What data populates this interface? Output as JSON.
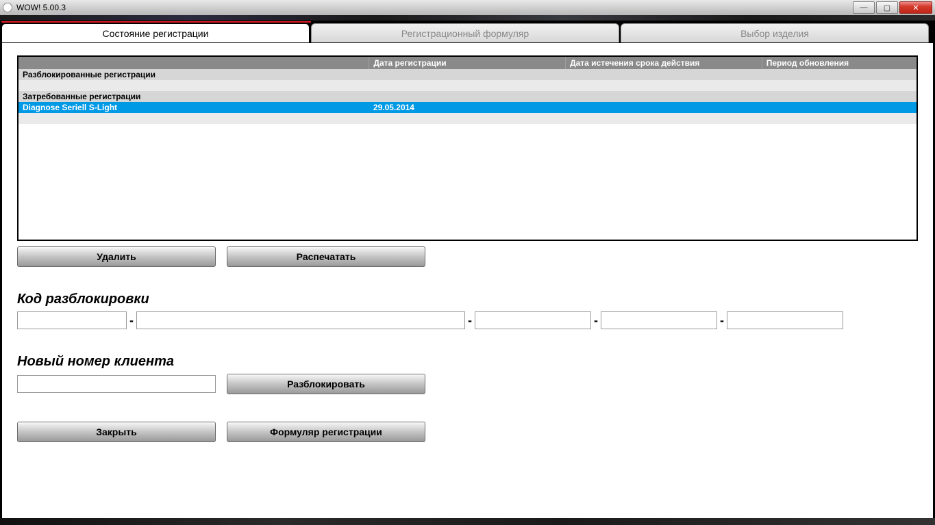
{
  "window": {
    "title": "WOW! 5.00.3"
  },
  "tabs": [
    {
      "label": "Состояние регистрации",
      "active": true
    },
    {
      "label": "Регистрационный формуляр",
      "active": false
    },
    {
      "label": "Выбор изделия",
      "active": false
    }
  ],
  "grid": {
    "headers": [
      "",
      "Дата регистрации",
      "Дата истечения срока действия",
      "Период обновления"
    ],
    "groups": [
      {
        "label": "Разблокированные регистрации",
        "rows": [
          {
            "name": "",
            "reg_date": "",
            "exp_date": "",
            "period": ""
          }
        ]
      },
      {
        "label": "Затребованные регистрации",
        "rows": [
          {
            "name": "Diagnose Seriell S-Light",
            "reg_date": "29.05.2014",
            "exp_date": "",
            "period": "",
            "selected": true
          },
          {
            "name": "",
            "reg_date": "",
            "exp_date": "",
            "period": ""
          }
        ]
      }
    ]
  },
  "buttons": {
    "delete": "Удалить",
    "print": "Распечатать",
    "unlock": "Разблокировать",
    "close": "Закрыть",
    "reg_form": "Формуляр регистрации"
  },
  "labels": {
    "unlock_code": "Код разблокировки",
    "new_customer": "Новый номер клиента"
  },
  "unlock_code": {
    "f1": "",
    "f2": "",
    "f3": "",
    "f4": "",
    "f5": ""
  },
  "new_customer_value": ""
}
